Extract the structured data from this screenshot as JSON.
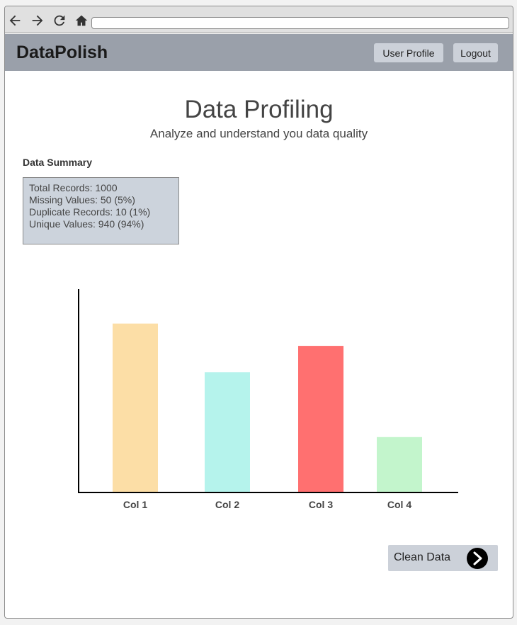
{
  "browser": {
    "address": ""
  },
  "header": {
    "brand": "DataPolish",
    "user_profile_label": "User Profile",
    "logout_label": "Logout"
  },
  "page": {
    "title": "Data Profiling",
    "subtitle": "Analyze and understand you data quality"
  },
  "summary": {
    "heading": "Data Summary",
    "lines": [
      "Total Records: 1000",
      "Missing Values: 50 (5%)",
      "Duplicate Records: 10 (1%)",
      "Unique Values: 940 (94%)"
    ]
  },
  "chart_data": {
    "type": "bar",
    "categories": [
      "Col 1",
      "Col 2",
      "Col 3",
      "Col 4"
    ],
    "values": [
      83,
      59,
      72,
      27
    ],
    "ylim": [
      0,
      100
    ],
    "colors": [
      "#fcdea6",
      "#b5f3ec",
      "#ff7070",
      "#c3f5cc"
    ],
    "grid": false
  },
  "actions": {
    "clean_data_label": "Clean Data"
  }
}
